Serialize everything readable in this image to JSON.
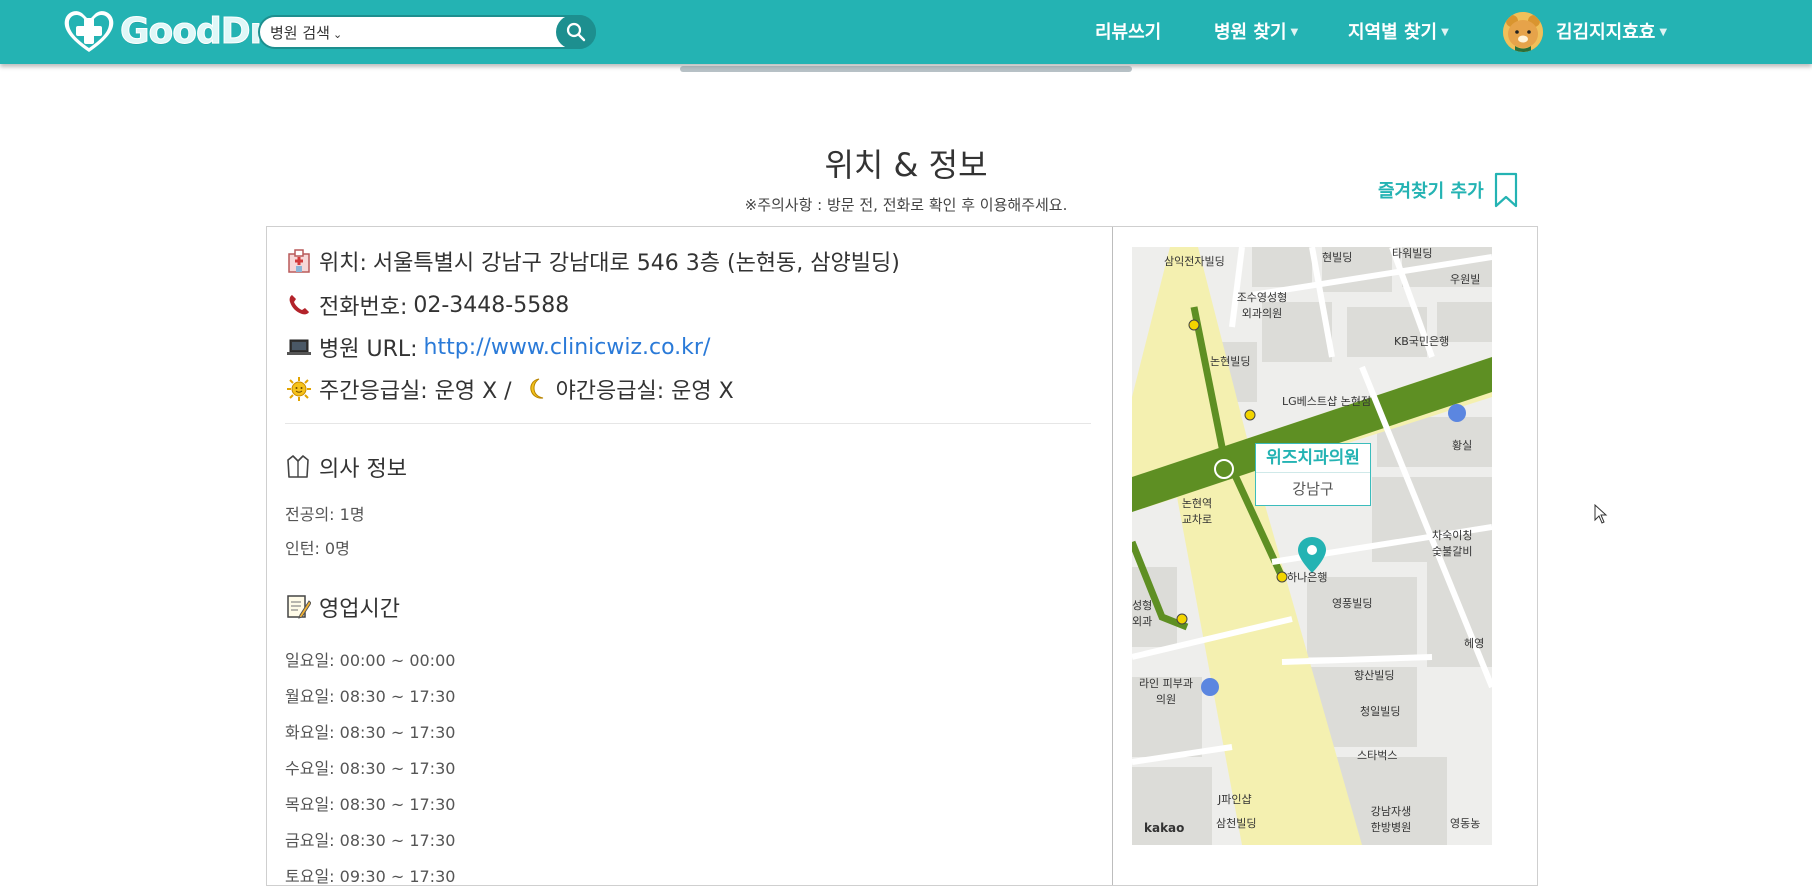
{
  "header": {
    "logo_text": "GoodDr.",
    "search": {
      "scope": "병원 검색",
      "placeholder": ""
    },
    "nav": [
      {
        "label": "리뷰쓰기",
        "has_caret": false
      },
      {
        "label": "병원 찾기",
        "has_caret": true
      },
      {
        "label": "지역별 찾기",
        "has_caret": true
      }
    ],
    "user": {
      "name": "김김지지효효"
    },
    "colors": {
      "brand": "#24b3b3",
      "brand_dark": "#1d8f8f"
    }
  },
  "section": {
    "title": "위치 & 정보",
    "note": "※주의사항 : 방문 전, 전화로 확인 후 이용해주세요.",
    "favorite_label": "즐겨찾기 추가"
  },
  "info": {
    "location_label": "위치: ",
    "location_value": "서울특별시 강남구 강남대로 546 3층 (논현동, 삼양빌딩)",
    "phone_label": "전화번호: ",
    "phone_value": "02-3448-5588",
    "url_label": "병원 URL: ",
    "url_value": "http://www.clinicwiz.co.kr/",
    "day_er": "주간응급실: 운영 X /",
    "night_er": "야간응급실: 운영 X"
  },
  "doctors": {
    "title": "의사 정보",
    "specialists": "전공의: 1명",
    "interns": "인턴: 0명"
  },
  "hours": {
    "title": "영업시간",
    "days": [
      "일요일: 00:00 ~ 00:00",
      "월요일: 08:30 ~ 17:30",
      "화요일: 08:30 ~ 17:30",
      "수요일: 08:30 ~ 17:30",
      "목요일: 08:30 ~ 17:30",
      "금요일: 08:30 ~ 17:30",
      "토요일: 09:30 ~ 17:30"
    ]
  },
  "map": {
    "marker_name": "위즈치과의원",
    "marker_area": "강남구",
    "labels": {
      "l1": "삼익전자빌딩",
      "l2": "현빌딩",
      "l3": "타워빌딩",
      "l4": "우원빌",
      "l5": "조수영성형 외과의원",
      "l6": "KB국민은행",
      "l7": "논현빌딩",
      "l8": "LG베스트샵 논현점",
      "l9": "황실",
      "l10": "논현역 교차로",
      "l11": "하나은행",
      "l12": "차숙이칭 숯불갈비",
      "l13": "영풍빌딩",
      "l14": "라인 피부과의원",
      "l15": "향산빌딩",
      "l16": "청일빌딩",
      "l17": "스타벅스",
      "l18": "J파인샵",
      "l19": "삼천빌딩",
      "l20": "강남자생 한방병원",
      "l21": "영동농",
      "l22": "kakao",
      "l23": "성형외과",
      "l24": "헤영"
    }
  }
}
